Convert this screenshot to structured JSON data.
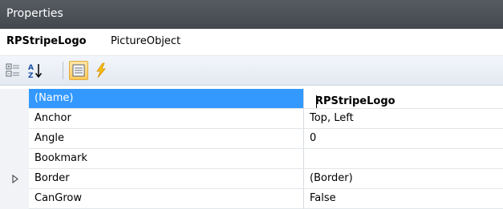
{
  "title": "Properties",
  "object": {
    "name": "RPStripeLogo",
    "type": "PictureObject"
  },
  "toolbar": {
    "buttons": [
      {
        "icon": "categorized-icon",
        "active": false
      },
      {
        "icon": "sort-alphabetical-icon",
        "active": false
      },
      {
        "icon": "property-pages-icon",
        "active": true
      },
      {
        "icon": "events-lightning-icon",
        "active": false
      }
    ]
  },
  "properties": [
    {
      "name": "(Name)",
      "value": "RPStripeLogo",
      "selected": true
    },
    {
      "name": "Anchor",
      "value": "Top, Left"
    },
    {
      "name": "Angle",
      "value": "0"
    },
    {
      "name": "Bookmark",
      "value": ""
    },
    {
      "name": "Border",
      "value": "(Border)",
      "expandable": true
    },
    {
      "name": "CanGrow",
      "value": "False"
    }
  ],
  "colors": {
    "selection": "#3399ff",
    "title_bar": "#4b5057",
    "active_button": "#ffc95a"
  }
}
